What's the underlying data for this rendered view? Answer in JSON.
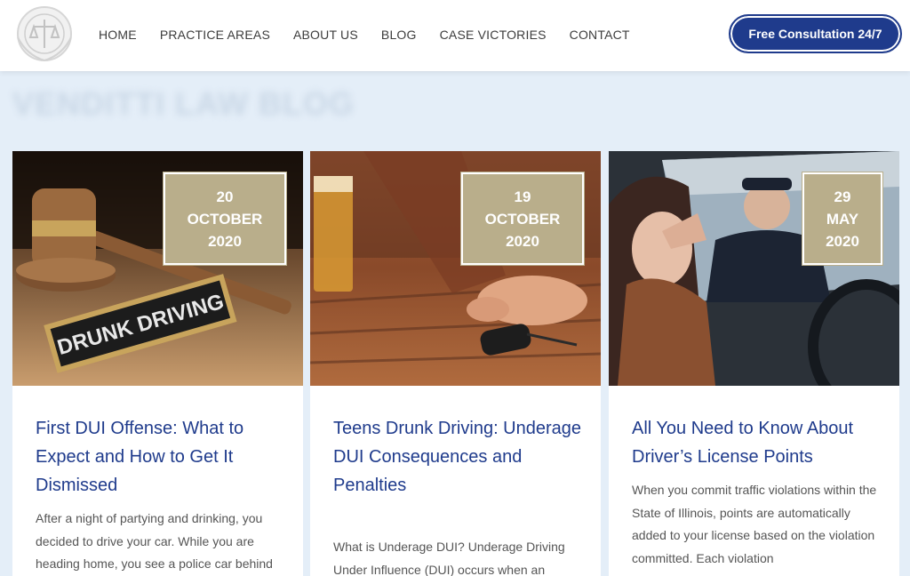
{
  "header": {
    "nav": [
      "HOME",
      "PRACTICE AREAS",
      "ABOUT US",
      "BLOG",
      "CASE VICTORIES",
      "CONTACT"
    ],
    "cta_label": "Free Consultation 24/7"
  },
  "page": {
    "blog_title": "VENDITTI LAW BLOG"
  },
  "cards": [
    {
      "date": {
        "day": "20",
        "month": "OCTOBER",
        "year": "2020"
      },
      "image_label": "DRUNK DRIVING",
      "title": "First DUI Offense: What to Expect and How to Get It Dismissed",
      "excerpt": "After a night of partying and drinking, you decided to drive your car. While you are heading home, you see a police car behind"
    },
    {
      "date": {
        "day": "19",
        "month": "OCTOBER",
        "year": "2020"
      },
      "title": "Teens Drunk Driving: Underage DUI Consequences and Penalties",
      "excerpt": "What is Underage DUI? Underage Driving Under Influence (DUI) occurs when an"
    },
    {
      "date": {
        "day": "29",
        "month": "MAY",
        "year": "2020"
      },
      "title": "All You Need to Know About Driver’s License Points",
      "excerpt": "When you commit traffic violations within the State of Illinois, points are automatically added to your license based on the violation committed. Each violation"
    }
  ],
  "colors": {
    "brand_blue": "#1f3b8c",
    "badge_tan": "#b9ae8b",
    "page_bg": "#e4eef8"
  }
}
